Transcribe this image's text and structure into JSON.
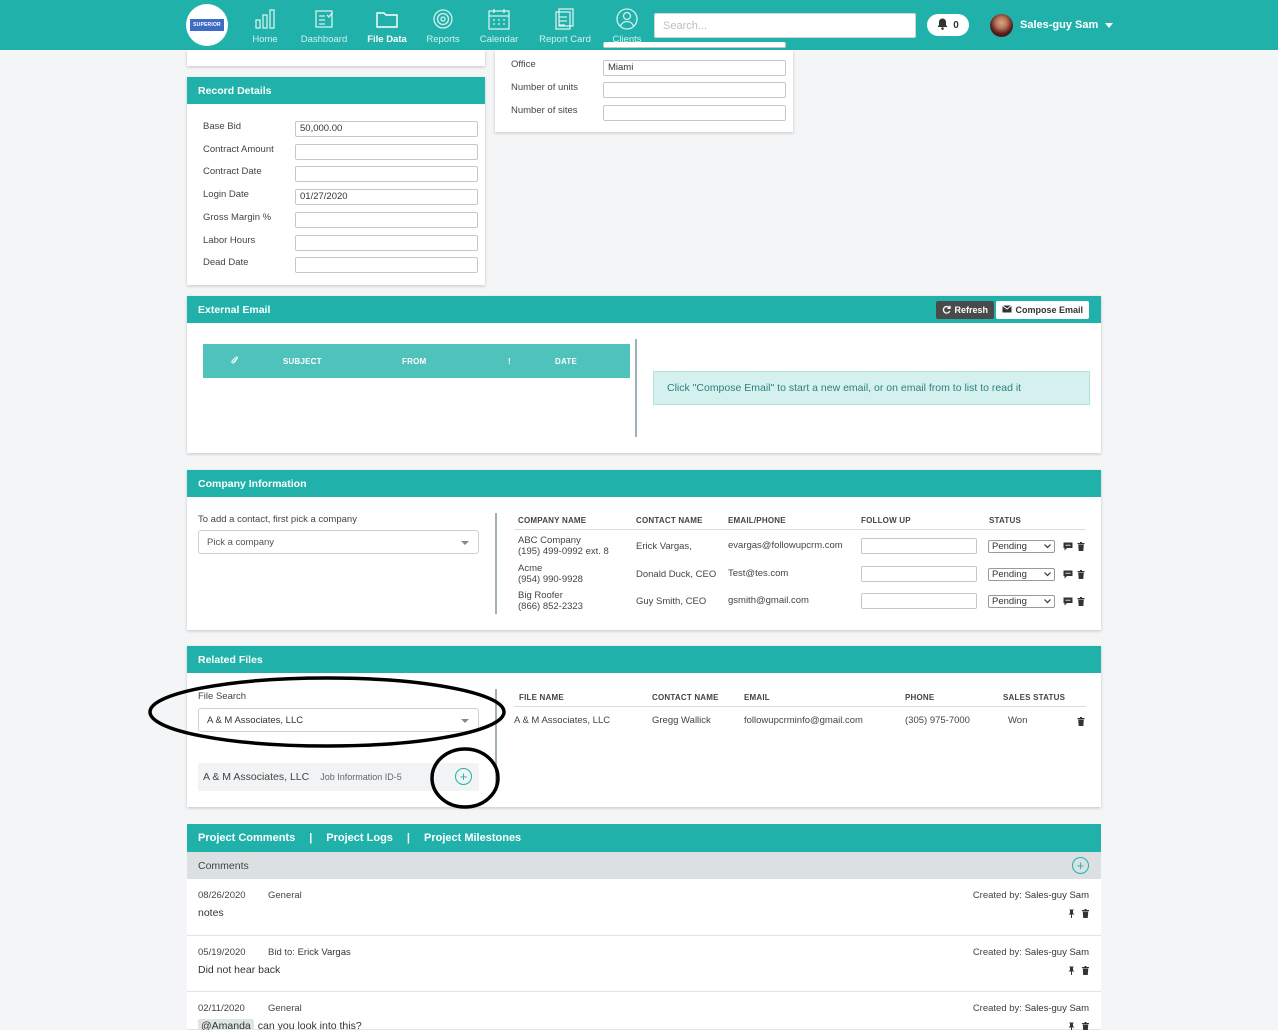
{
  "nav": {
    "logo_text": "SUPERIOR",
    "items": [
      {
        "label": "Home",
        "icon": "bar-chart-icon"
      },
      {
        "label": "Dashboard",
        "icon": "clipboard-icon"
      },
      {
        "label": "File Data",
        "icon": "folder-icon",
        "active": true
      },
      {
        "label": "Reports",
        "icon": "target-icon"
      },
      {
        "label": "Calendar",
        "icon": "calendar-icon"
      },
      {
        "label": "Report Card",
        "icon": "report-card-icon"
      },
      {
        "label": "Clients",
        "icon": "user-icon"
      }
    ],
    "search_placeholder": "Search...",
    "notification_count": "0",
    "user_name": "Sales-guy Sam"
  },
  "office_panel": {
    "fields": [
      {
        "label": "Office",
        "value": "Miami"
      },
      {
        "label": "Number of units",
        "value": ""
      },
      {
        "label": "Number of sites",
        "value": ""
      }
    ]
  },
  "record_details": {
    "title": "Record Details",
    "fields": [
      {
        "label": "Base Bid",
        "value": "50,000.00"
      },
      {
        "label": "Contract Amount",
        "value": ""
      },
      {
        "label": "Contract Date",
        "value": ""
      },
      {
        "label": "Login Date",
        "value": "01/27/2020"
      },
      {
        "label": "Gross Margin %",
        "value": ""
      },
      {
        "label": "Labor Hours",
        "value": ""
      },
      {
        "label": "Dead Date",
        "value": ""
      }
    ]
  },
  "external_email": {
    "title": "External Email",
    "refresh_label": "Refresh",
    "compose_label": "Compose Email",
    "columns": [
      "SUBJECT",
      "FROM",
      "!",
      "DATE"
    ],
    "info": "Click \"Compose Email\" to start a new email, or on email from to list to read it"
  },
  "company_info": {
    "title": "Company Information",
    "hint": "To add a contact, first pick a company",
    "pick_placeholder": "Pick a company",
    "columns": [
      "COMPANY NAME",
      "CONTACT NAME",
      "EMAIL/PHONE",
      "FOLLOW UP",
      "STATUS"
    ],
    "rows": [
      {
        "company": "ABC Company",
        "phone": "(195) 499-0992 ext. 8",
        "contact": "Erick Vargas,",
        "email": "evargas@followupcrm.com",
        "status": "Pending"
      },
      {
        "company": "Acme",
        "phone": "(954) 990-9928",
        "contact": "Donald Duck, CEO",
        "email": "Test@tes.com",
        "status": "Pending"
      },
      {
        "company": "Big Roofer",
        "phone": "(866) 852-2323",
        "contact": "Guy Smith, CEO",
        "email": "gsmith@gmail.com",
        "status": "Pending"
      }
    ]
  },
  "related_files": {
    "title": "Related Files",
    "search_label": "File Search",
    "search_value": "A & M Associates, LLC",
    "result_name": "A & M Associates, LLC",
    "result_meta": "Job Information ID-5",
    "columns": [
      "FILE NAME",
      "CONTACT NAME",
      "EMAIL",
      "PHONE",
      "SALES STATUS"
    ],
    "rows": [
      {
        "file": "A & M Associates, LLC",
        "contact": "Gregg Wallick",
        "email": "followupcrminfo@gmail.com",
        "phone": "(305) 975-7000",
        "status": "Won"
      }
    ]
  },
  "project_tabs": [
    "Project Comments",
    "Project Logs",
    "Project Milestones"
  ],
  "comments": {
    "header": "Comments",
    "created_prefix": "Created by:",
    "items": [
      {
        "date": "08/26/2020",
        "type": "General",
        "bid_prefix": "",
        "bid_name": "",
        "author": "Sales-guy Sam",
        "text": "notes"
      },
      {
        "date": "05/19/2020",
        "type": "Bid to:",
        "bid_prefix": "Bid to:",
        "bid_name": "Erick Vargas",
        "author": "Sales-guy Sam",
        "text": "Did not hear back"
      },
      {
        "date": "02/11/2020",
        "type": "General",
        "bid_prefix": "",
        "bid_name": "",
        "author": "Sales-guy Sam",
        "mention": "@Amanda",
        "text": "can you look into this?"
      }
    ]
  },
  "colors": {
    "accent": "#20b2aa",
    "info_bg": "#d4f1ef"
  }
}
